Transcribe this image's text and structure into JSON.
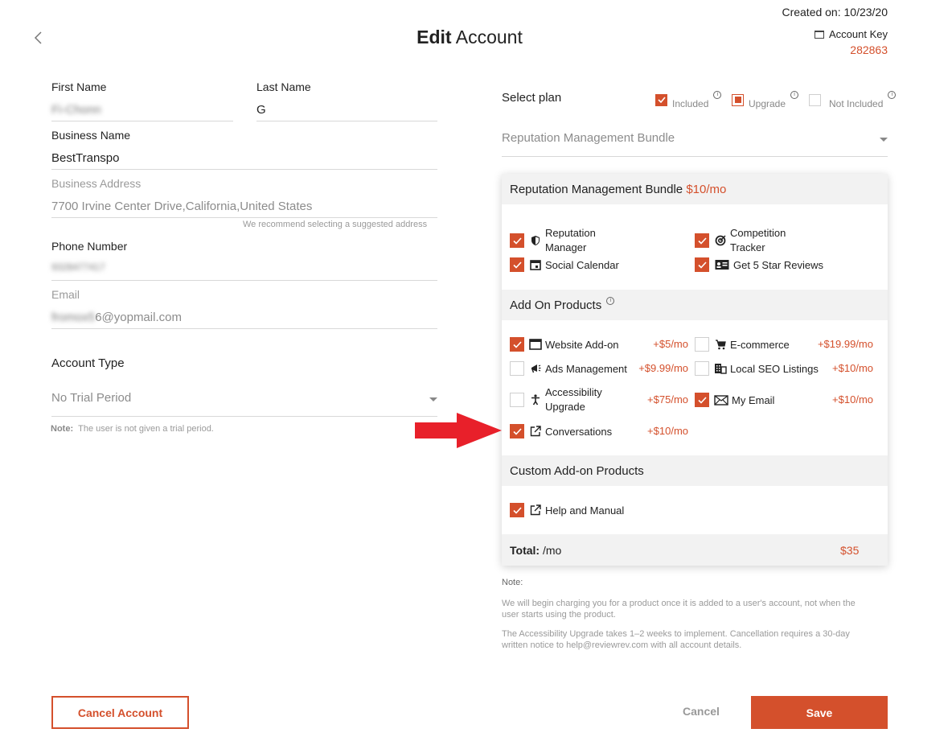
{
  "header": {
    "title_bold": "Edit",
    "title_rest": "Account",
    "created_on": "Created on: 10/23/20",
    "account_key_label": "Account Key",
    "account_key_value": "282863"
  },
  "form": {
    "first_name": {
      "label": "First Name",
      "value": "Fi-Chonn"
    },
    "last_name": {
      "label": "Last Name",
      "value": "G"
    },
    "business_name": {
      "label": "Business Name",
      "value": "BestTranspo"
    },
    "business_address": {
      "label": "Business Address",
      "value": "7700 Irvine Center Drive,California,United States",
      "hint": "We recommend selecting a suggested address"
    },
    "phone": {
      "label": "Phone Number",
      "value": "9328477417"
    },
    "email": {
      "label": "Email",
      "value_hidden": "fromox5",
      "value_visible": "6@yopmail.com"
    },
    "account_type": {
      "label": "Account Type",
      "value": "No Trial Period"
    },
    "note_label": "Note:",
    "note_text": "The user is not given a trial period."
  },
  "plan": {
    "label": "Select plan",
    "legend": {
      "included": "Included",
      "upgrade": "Upgrade",
      "not_included": "Not Included"
    },
    "selected": "Reputation Management Bundle"
  },
  "card": {
    "bundle_title": "Reputation Management Bundle",
    "bundle_price": "$10/mo",
    "bundle_items": [
      {
        "line1": "Reputation",
        "line2": "Manager",
        "icon": "shield-icon"
      },
      {
        "line1": "Competition",
        "line2": "Tracker",
        "icon": "target-icon"
      },
      {
        "line1": "Social Calendar",
        "line2": "",
        "icon": "calendar-icon"
      },
      {
        "line1": "Get 5 Star Reviews",
        "line2": "",
        "icon": "review-card-icon"
      }
    ],
    "addons_title": "Add On Products",
    "addons": [
      {
        "label": "Website Add-on",
        "price": "+$5/mo",
        "checked": true,
        "icon": "browser-window-icon"
      },
      {
        "label": "E-commerce",
        "price": "+$19.99/mo",
        "checked": false,
        "icon": "cart-icon"
      },
      {
        "label": "Ads Management",
        "price": "+$9.99/mo",
        "checked": false,
        "icon": "megaphone-icon"
      },
      {
        "label": "Local SEO Listings",
        "price": "+$10/mo",
        "checked": false,
        "icon": "building-icon"
      },
      {
        "label1": "Accessibility",
        "label2": "Upgrade",
        "price": "+$75/mo",
        "checked": false,
        "icon": "accessibility-icon"
      },
      {
        "label": "My Email",
        "price": "+$10/mo",
        "checked": true,
        "icon": "envelope-icon"
      },
      {
        "label": "Conversations",
        "price": "+$10/mo",
        "checked": true,
        "icon": "external-link-icon"
      }
    ],
    "custom_title": "Custom Add-on Products",
    "custom_items": [
      {
        "label": "Help and Manual",
        "checked": true,
        "icon": "external-link-icon"
      }
    ],
    "total_label": "Total:",
    "total_unit": "/mo",
    "total_value": "$35"
  },
  "notes": {
    "heading": "Note:",
    "line1a": "We will begin charging you for a product once it is added to a user's account, not when the",
    "line1b": "user starts using the product.",
    "line2a": "The Accessibility Upgrade takes 1–2 weeks to implement. Cancellation requires a 30-day",
    "line2b": "written notice to help@reviewrev.com with all account details."
  },
  "buttons": {
    "cancel_account": "Cancel Account",
    "cancel": "Cancel",
    "save": "Save"
  },
  "colors": {
    "accent": "#d4502c",
    "arrow": "#e8202a"
  }
}
